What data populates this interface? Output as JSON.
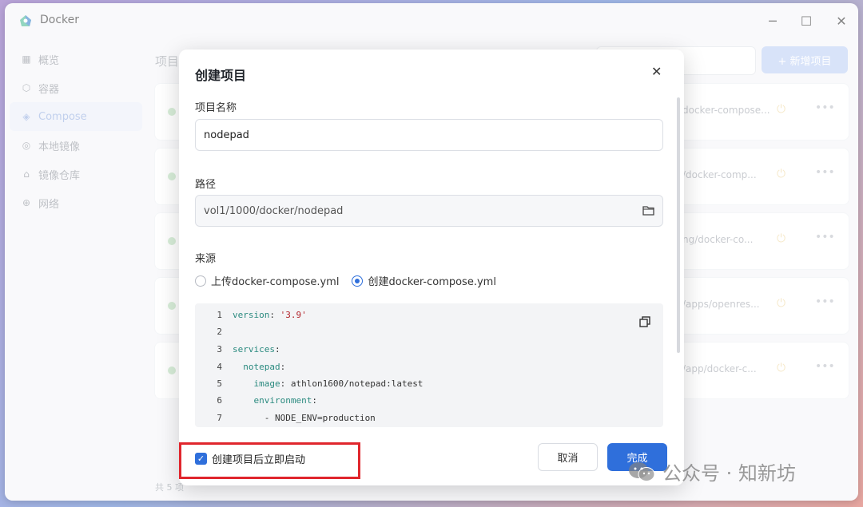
{
  "app": {
    "title": "Docker",
    "logo_icon": "docker-logo-icon"
  },
  "window_controls": {
    "minimize": "─",
    "maximize": "☐",
    "close": "✕"
  },
  "sidebar": {
    "items": [
      {
        "label": "概览",
        "icon": "overview-icon"
      },
      {
        "label": "容器",
        "icon": "container-icon"
      },
      {
        "label": "Compose",
        "icon": "compose-icon",
        "active": true
      },
      {
        "label": "本地镜像",
        "icon": "image-icon"
      },
      {
        "label": "镜像仓库",
        "icon": "registry-icon"
      },
      {
        "label": "网络",
        "icon": "network-icon"
      }
    ]
  },
  "content": {
    "title": "项目",
    "new_button": "+ 新增项目",
    "rows": [
      {
        "path": "docker-compose..."
      },
      {
        "path": "/docker-comp..."
      },
      {
        "path": "ng/docker-co..."
      },
      {
        "path": "/apps/openres..."
      },
      {
        "path": "/app/docker-c..."
      }
    ],
    "footer": "共 5 项"
  },
  "dialog": {
    "title": "创建项目",
    "name_label": "项目名称",
    "name_value": "nodepad",
    "path_label": "路径",
    "path_value": "vol1/1000/docker/nodepad",
    "source_label": "来源",
    "source_options": [
      {
        "label": "上传docker-compose.yml",
        "checked": false
      },
      {
        "label": "创建docker-compose.yml",
        "checked": true
      }
    ],
    "code_lines": [
      {
        "n": "1",
        "text": "version: '3.9'"
      },
      {
        "n": "2",
        "text": ""
      },
      {
        "n": "3",
        "text": "services:"
      },
      {
        "n": "4",
        "text": "  notepad:"
      },
      {
        "n": "5",
        "text": "    image: athlon1600/notepad:latest"
      },
      {
        "n": "6",
        "text": "    environment:"
      },
      {
        "n": "7",
        "text": "      - NODE_ENV=production"
      }
    ],
    "autostart_label": "创建项目后立即启动",
    "autostart_checked": true,
    "cancel_label": "取消",
    "ok_label": "完成"
  },
  "watermark": {
    "text": "公众号 · 知新坊"
  },
  "colors": {
    "accent": "#2f6fdb",
    "highlight": "#e0262d"
  }
}
